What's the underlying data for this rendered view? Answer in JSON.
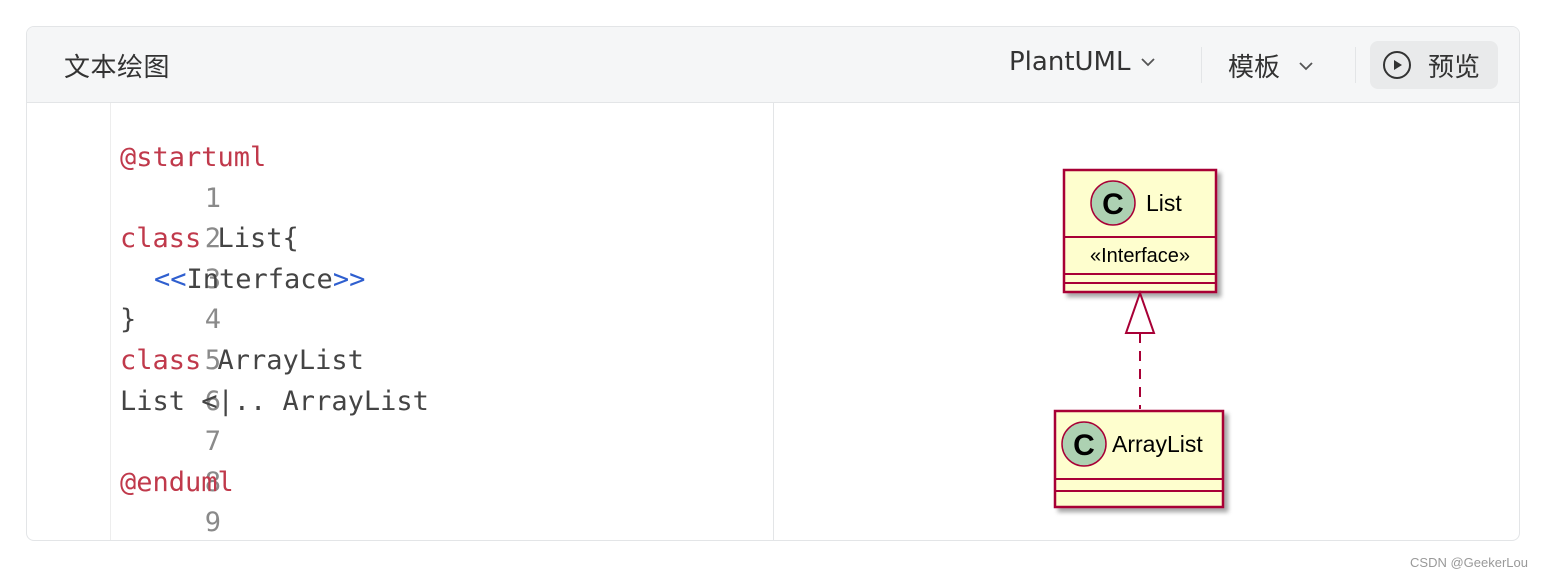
{
  "header": {
    "title": "文本绘图",
    "language_dropdown": "PlantUML",
    "template_dropdown": "模板",
    "preview_button": "预览"
  },
  "editor": {
    "line_numbers": [
      "1",
      "2",
      "3",
      "4",
      "5",
      "6",
      "7",
      "8",
      "9"
    ],
    "code": {
      "l1": "@startuml",
      "l3_kw": "class",
      "l3_rest": " List{",
      "l4_open": "<<",
      "l4_text": "Interface",
      "l4_close": ">>",
      "l5": "}",
      "l6_kw": "class",
      "l6_rest": " ArrayList",
      "l7": "List <|.. ArrayList",
      "l9": "@enduml"
    }
  },
  "diagram": {
    "class_list": {
      "name": "List",
      "stereotype": "«Interface»",
      "badge": "C"
    },
    "class_arraylist": {
      "name": "ArrayList",
      "badge": "C"
    },
    "colors": {
      "fill": "#fefece",
      "border": "#a80036",
      "badge": "#add1b2"
    }
  },
  "watermark": "CSDN @GeekerLou"
}
